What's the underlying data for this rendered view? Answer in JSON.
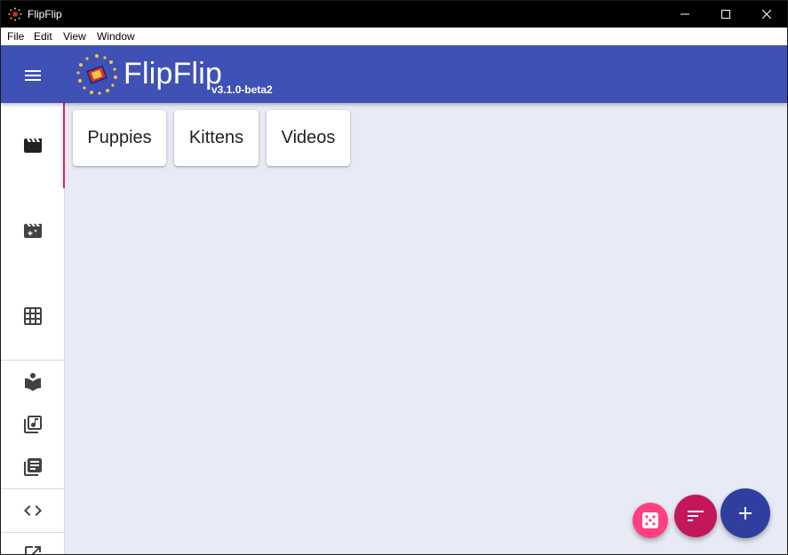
{
  "window": {
    "title": "FlipFlip",
    "controls": [
      "minimize-icon",
      "maximize-icon",
      "close-icon"
    ]
  },
  "menubar": {
    "items": [
      "File",
      "Edit",
      "View",
      "Window"
    ]
  },
  "appbar": {
    "menu_icon": "menu-icon",
    "brand_name": "FlipFlip",
    "version": "v3.1.0-beta2",
    "color": "#3f51b5"
  },
  "sidebar": {
    "items": [
      {
        "icon": "scenes-clapperboard-icon",
        "active": true
      },
      {
        "icon": "scene-generator-icon",
        "active": false
      },
      {
        "icon": "grid-icon",
        "active": false
      },
      {
        "icon": "library-reader-icon",
        "active": false
      },
      {
        "icon": "audio-library-icon",
        "active": false
      },
      {
        "icon": "script-library-icon",
        "active": false
      },
      {
        "icon": "code-icon",
        "active": false
      },
      {
        "icon": "open-in-new-icon",
        "active": false
      }
    ],
    "active_indicator_color": "#e91e63"
  },
  "main": {
    "scenes": [
      "Puppies",
      "Kittens",
      "Videos"
    ]
  },
  "fabs": [
    {
      "icon": "dice-icon",
      "color": "#ff4081"
    },
    {
      "icon": "sort-icon",
      "color": "#c2185b"
    },
    {
      "icon": "add-icon",
      "color": "#303f9f"
    }
  ]
}
